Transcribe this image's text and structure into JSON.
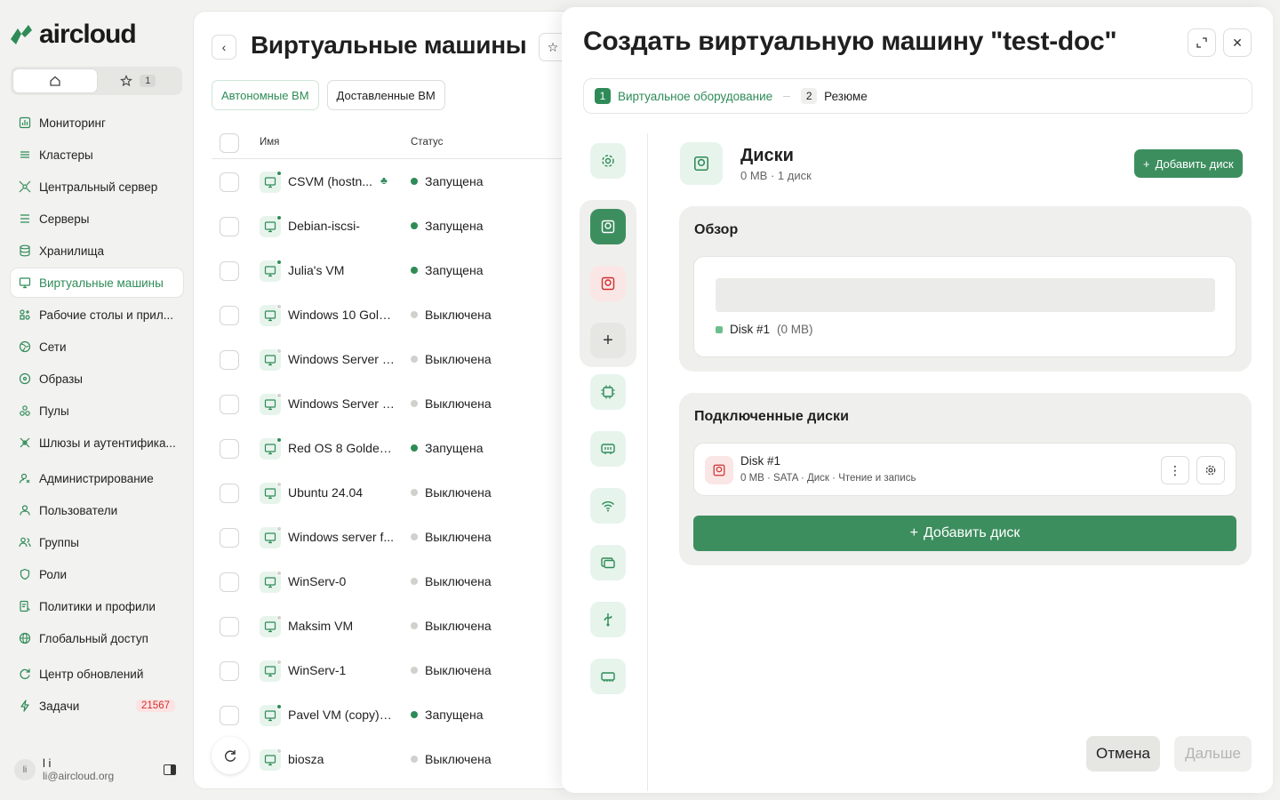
{
  "brand": {
    "name": "aircloud",
    "accent": "#2e8b57"
  },
  "quick_tabs": {
    "home_icon": "home-icon",
    "favorites_icon": "star-icon",
    "favorites_count": "1"
  },
  "nav": {
    "items": [
      {
        "label": "Мониторинг",
        "icon": "chart-icon"
      },
      {
        "label": "Кластеры",
        "icon": "layers-icon"
      },
      {
        "label": "Центральный сервер",
        "icon": "hub-icon"
      },
      {
        "label": "Серверы",
        "icon": "server-icon"
      },
      {
        "label": "Хранилища",
        "icon": "database-icon"
      },
      {
        "label": "Виртуальные машины",
        "icon": "monitor-icon",
        "active": true
      },
      {
        "label": "Рабочие столы и прил...",
        "icon": "apps-icon"
      },
      {
        "label": "Сети",
        "icon": "globe-icon"
      },
      {
        "label": "Образы",
        "icon": "disc-icon"
      },
      {
        "label": "Пулы",
        "icon": "pools-icon"
      },
      {
        "label": "Шлюзы и аутентифика...",
        "icon": "gateway-icon"
      },
      {
        "label": "Администрирование",
        "icon": "admin-icon"
      },
      {
        "label": "Пользователи",
        "icon": "user-icon"
      },
      {
        "label": "Группы",
        "icon": "users-icon"
      },
      {
        "label": "Роли",
        "icon": "shield-icon"
      },
      {
        "label": "Политики и профили",
        "icon": "policy-icon"
      },
      {
        "label": "Глобальный доступ",
        "icon": "world-icon"
      },
      {
        "label": "Центр обновлений",
        "icon": "refresh-icon"
      },
      {
        "label": "Задачи",
        "icon": "bolt-icon",
        "badge": "21567"
      }
    ]
  },
  "user": {
    "name": "l i",
    "email": "li@aircloud.org",
    "avatar": "li"
  },
  "main": {
    "title": "Виртуальные машины",
    "tabs": [
      "Автономные ВМ",
      "Доставленные ВМ"
    ],
    "columns": {
      "name": "Имя",
      "status": "Статус"
    },
    "rows": [
      {
        "name": "CSVM (hostn...",
        "status": "Запущена",
        "running": true,
        "extra_icon": true
      },
      {
        "name": "Debian-iscsi-",
        "status": "Запущена",
        "running": true
      },
      {
        "name": "Julia's VM",
        "status": "Запущена",
        "running": true
      },
      {
        "name": "Windows 10 Gold...",
        "status": "Выключена",
        "running": false
      },
      {
        "name": "Windows Server 2...",
        "status": "Выключена",
        "running": false
      },
      {
        "name": "Windows Server 2...",
        "status": "Выключена",
        "running": false
      },
      {
        "name": "Red OS 8 Golden ...",
        "status": "Запущена",
        "running": true
      },
      {
        "name": "Ubuntu 24.04",
        "status": "Выключена",
        "running": false
      },
      {
        "name": "Windows server f...",
        "status": "Выключена",
        "running": false
      },
      {
        "name": "WinServ-0",
        "status": "Выключена",
        "running": false
      },
      {
        "name": "Maksim VM",
        "status": "Выключена",
        "running": false
      },
      {
        "name": "WinServ-1",
        "status": "Выключена",
        "running": false
      },
      {
        "name": "Pavel VM (copy) de",
        "status": "Запущена",
        "running": true
      },
      {
        "name": "biosza",
        "status": "Выключена",
        "running": false
      }
    ],
    "colors": {
      "running": "#2e8b57",
      "stopped": "#d0d0cd"
    }
  },
  "drawer": {
    "title": "Создать виртуальную машину \"test-doc\"",
    "steps": [
      {
        "num": "1",
        "label": "Виртуальное оборудование",
        "active": true
      },
      {
        "num": "2",
        "label": "Резюме",
        "active": false
      }
    ],
    "section": {
      "title": "Диски",
      "subtitle": "0 MB · 1 диск",
      "add_small": "Добавить диск"
    },
    "overview": {
      "title": "Обзор",
      "legend_name": "Disk #1",
      "legend_size": "(0 MB)"
    },
    "attached": {
      "title": "Подключенные диски",
      "disk_name": "Disk #1",
      "disk_meta": "0 MB · SATA · Диск · Чтение и запись",
      "add_big": "Добавить диск"
    },
    "footer": {
      "cancel": "Отмена",
      "next": "Дальше"
    }
  }
}
